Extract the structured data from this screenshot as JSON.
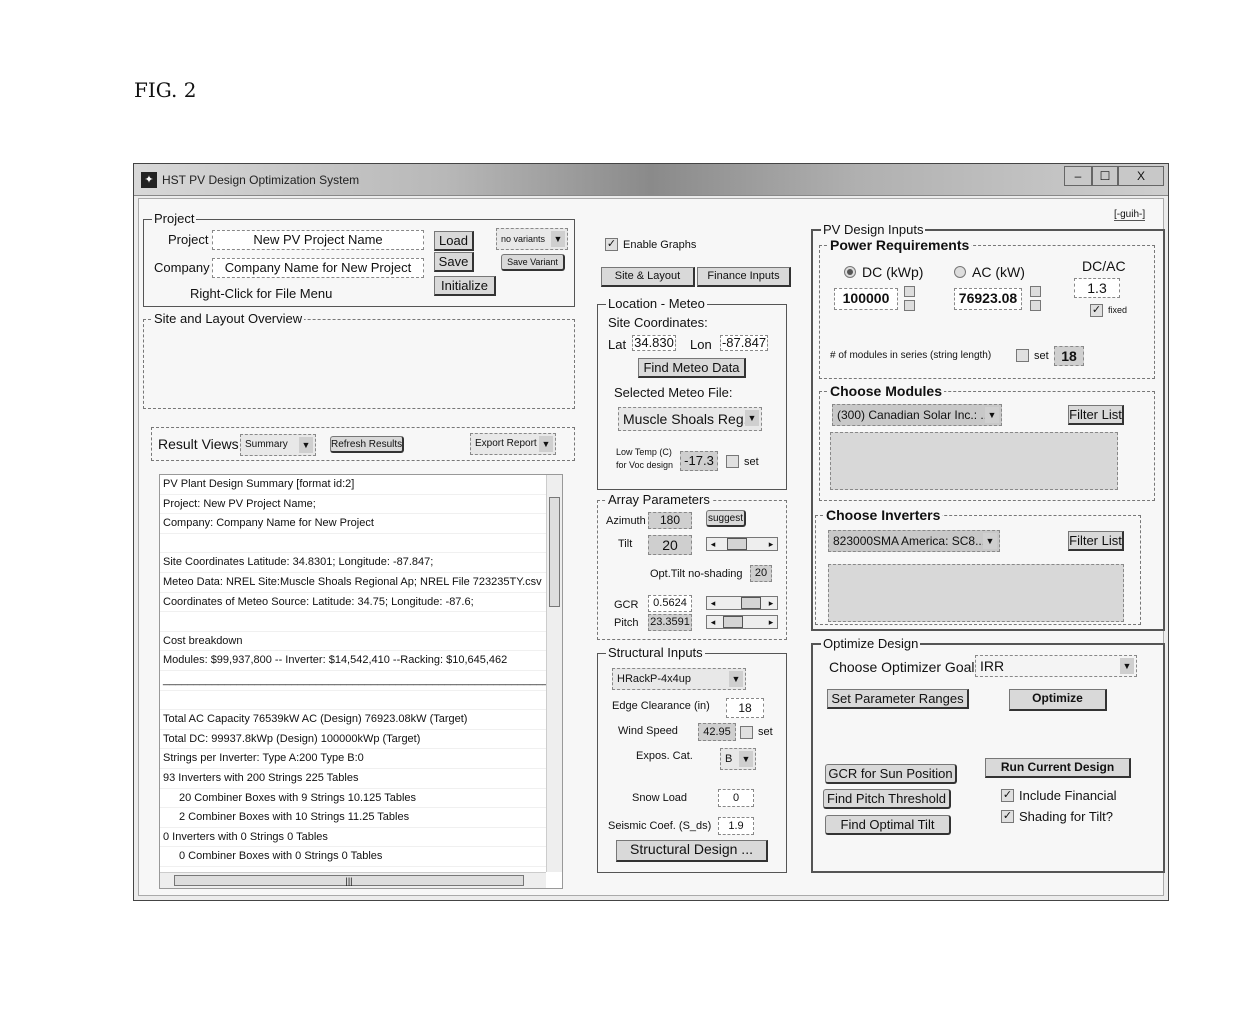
{
  "figure_label": "FIG. 2",
  "window": {
    "title": "HST PV Design Optimization System",
    "controls": {
      "minimize": "‒",
      "maximize": "☐",
      "close": "X"
    },
    "guih_link": "[-guih-]"
  },
  "project": {
    "group_label": "Project",
    "project_label": "Project",
    "project_value": "New PV Project Name",
    "company_label": "Company",
    "company_value": "Company Name for New Project",
    "hint": "Right-Click for File Menu",
    "load_button": "Load",
    "save_button": "Save",
    "initialize_button": "Initialize",
    "variants_select": "no variants",
    "save_variant_button": "Save Variant"
  },
  "site_overview": {
    "group_label": "Site and Layout Overview"
  },
  "results": {
    "label": "Result Views",
    "view_select": "Summary",
    "refresh_button": "Refresh Results",
    "export_select": "Export Report",
    "lines": [
      {
        "text": "PV Plant Design Summary [format id:2]",
        "indent": false
      },
      {
        "text": "Project: New PV Project Name;",
        "indent": false
      },
      {
        "text": "Company: Company Name for New Project",
        "indent": false
      },
      {
        "text": "",
        "indent": false
      },
      {
        "text": "Site Coordinates Latitude: 34.8301; Longitude: -87.847;",
        "indent": false
      },
      {
        "text": "Meteo Data: NREL Site:Muscle Shoals Regional Ap;  NREL File 723235TY.csv",
        "indent": false
      },
      {
        "text": "Coordinates of Meteo Source: Latitude: 34.75; Longitude: -87.6;",
        "indent": false
      },
      {
        "text": "",
        "indent": false
      },
      {
        "text": "Cost breakdown",
        "indent": false
      },
      {
        "text": " Modules: $99,937,800 -- Inverter: $14,542,410 --Racking: $10,645,462",
        "indent": false
      },
      {
        "text": "________________________________________________________________________________...",
        "indent": false
      },
      {
        "text": "",
        "indent": false
      },
      {
        "text": "Total AC Capacity 76539kW AC (Design)    76923.08kW (Target)",
        "indent": false
      },
      {
        "text": "Total DC: 99937.8kWp (Design) 100000kWp (Target)",
        "indent": false
      },
      {
        "text": "Strings per Inverter: Type A:200   Type B:0",
        "indent": false
      },
      {
        "text": "93 Inverters with 200  Strings 225  Tables",
        "indent": false
      },
      {
        "text": "20 Combiner Boxes with 9 Strings 10.125 Tables",
        "indent": true
      },
      {
        "text": "2 Combiner Boxes with 10 Strings 11.25 Tables",
        "indent": true
      },
      {
        "text": "0 Inverters with 0  Strings 0  Tables",
        "indent": false
      },
      {
        "text": "0 Combiner Boxes with 0 Strings 0 Tables",
        "indent": true
      }
    ]
  },
  "middle": {
    "enable_graphs_label": "Enable Graphs",
    "enable_graphs_checked": true,
    "site_layout_button": "Site & Layout",
    "finance_inputs_button": "Finance Inputs"
  },
  "location": {
    "group_label": "Location - Meteo",
    "site_coords_label": "Site Coordinates:",
    "lat_label": "Lat",
    "lat_value": "34.830",
    "lon_label": "Lon",
    "lon_value": "-87.847",
    "find_meteo_button": "Find Meteo Data",
    "selected_file_label": "Selected Meteo File:",
    "meteo_file_select": "Muscle Shoals Reg...",
    "low_temp_label_1": "Low Temp (C)",
    "low_temp_label_2": "for Voc design",
    "low_temp_value": "-17.3",
    "set_label": "set"
  },
  "array": {
    "group_label": "Array Parameters",
    "azimuth_label": "Azimuth",
    "azimuth_value": "180",
    "suggest_button": "suggest",
    "tilt_label": "Tilt",
    "tilt_value": "20",
    "opt_tilt_label": "Opt.Tilt no-shading",
    "opt_tilt_value": "20",
    "gcr_label": "GCR",
    "gcr_value": "0.5624",
    "pitch_label": "Pitch",
    "pitch_value": "23.3591"
  },
  "structural": {
    "group_label": "Structural Inputs",
    "racking_select": "HRackP-4x4up",
    "edge_label": "Edge Clearance (in)",
    "edge_value": "18",
    "wind_label": "Wind Speed",
    "wind_value": "42.95",
    "set_label": "set",
    "expos_label": "Expos. Cat.",
    "expos_select": "B",
    "snow_label": "Snow Load",
    "snow_value": "0",
    "seismic_label": "Seismic Coef. (S_ds)",
    "seismic_value": "1.9",
    "design_button": "Structural Design ..."
  },
  "pv_inputs": {
    "group_label": "PV Design Inputs",
    "power": {
      "group_label": "Power Requirements",
      "dc_label": "DC (kWp)",
      "dc_selected": true,
      "dc_value": "100000",
      "ac_label": "AC (kW)",
      "ac_value": "76923.08",
      "dcac_label": "DC/AC",
      "dcac_value": "1.3",
      "fixed_label": "fixed",
      "fixed_checked": true,
      "string_label": "# of modules in series (string length)",
      "string_set_label": "set",
      "string_value": "18"
    },
    "modules": {
      "group_label": "Choose Modules",
      "select": "(300) Canadian Solar Inc.: ...",
      "filter_button": "Filter List"
    },
    "inverters": {
      "group_label": "Choose Inverters",
      "select": "823000SMA America: SC8...",
      "filter_button": "Filter List"
    }
  },
  "optimize": {
    "group_label": "Optimize Design",
    "goal_label": "Choose Optimizer Goal",
    "goal_select": "IRR",
    "set_ranges_button": "Set Parameter Ranges",
    "optimize_button": "Optimize",
    "gcr_sun_button": "GCR for Sun Position",
    "pitch_threshold_button": "Find Pitch Threshold",
    "optimal_tilt_button": "Find Optimal Tilt",
    "run_design_button": "Run Current Design",
    "include_financial_label": "Include Financial",
    "include_financial_checked": true,
    "shading_tilt_label": "Shading for Tilt?",
    "shading_tilt_checked": true
  }
}
